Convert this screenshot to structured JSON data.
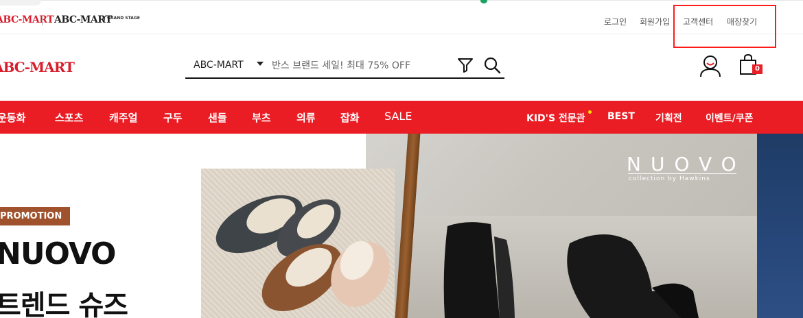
{
  "header": {
    "brand_primary": "ABC-MART",
    "brand_secondary": "ABC-MART",
    "brand_secondary_tag": "GRAND STAGE",
    "links": {
      "login": "로그인",
      "signup": "회원가입",
      "customer_center": "고객센터",
      "store_finder": "매장찾기"
    }
  },
  "search": {
    "logo": "ABC-MART",
    "scope_selected": "ABC-MART",
    "placeholder": "반스 브랜드 세일! 최대 75% OFF"
  },
  "cart": {
    "count": "0"
  },
  "nav": {
    "left": [
      "운동화",
      "스포츠",
      "캐주얼",
      "구두",
      "샌들",
      "부츠",
      "의류",
      "잡화",
      "SALE"
    ],
    "right": [
      "KID'S 전문관",
      "BEST",
      "기획전",
      "이벤트/쿠폰"
    ]
  },
  "hero": {
    "badge": "PROMOTION",
    "headline": "NUOVO",
    "subheadline": "트렌드 슈즈",
    "brand_logo": "NUOVO",
    "brand_logo_sub": "collection by Hawkins"
  },
  "colors": {
    "brand_red": "#ea1c24",
    "highlight_box": "#ff1a1a",
    "badge_brown": "#a0522d"
  }
}
